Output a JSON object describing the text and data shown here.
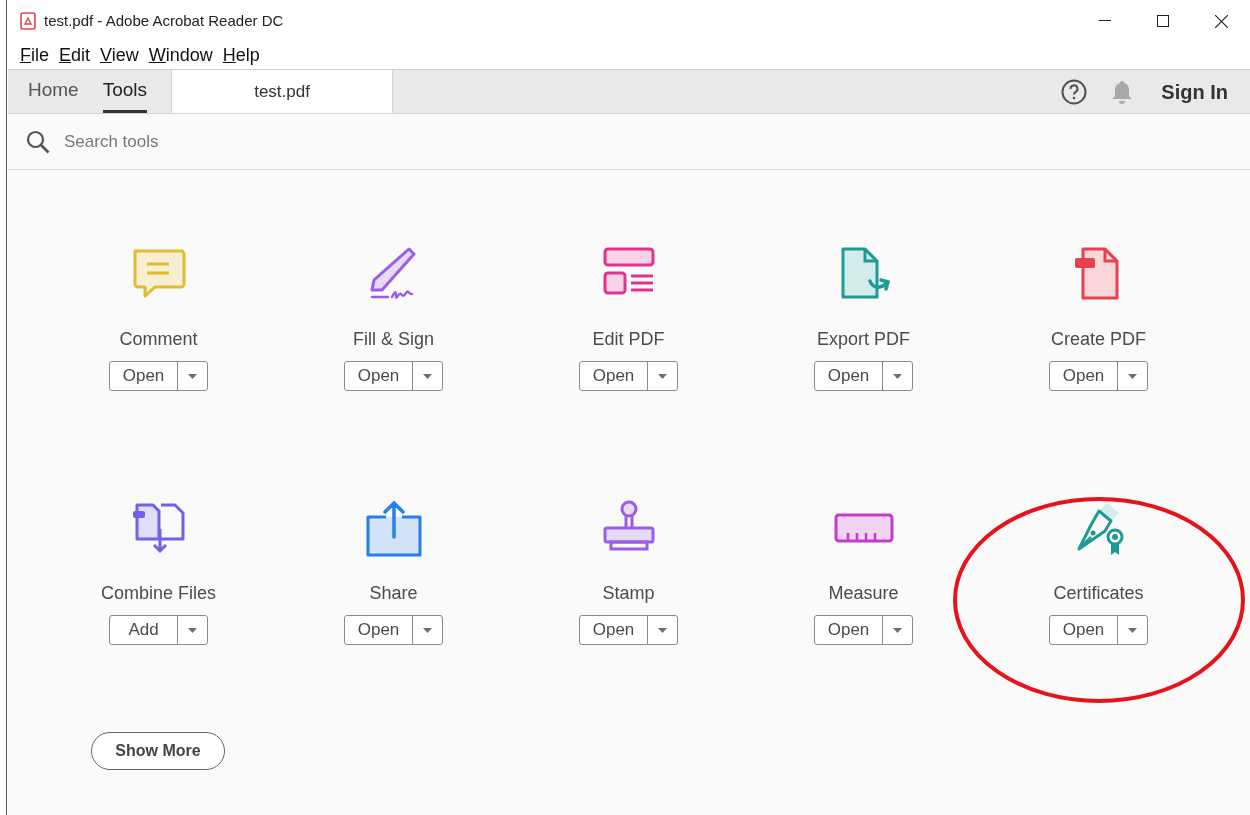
{
  "window": {
    "title": "test.pdf - Adobe Acrobat Reader DC"
  },
  "menu": [
    {
      "label": "File"
    },
    {
      "label": "Edit"
    },
    {
      "label": "View"
    },
    {
      "label": "Window"
    },
    {
      "label": "Help"
    }
  ],
  "tabs": [
    {
      "label": "Home",
      "selected": false
    },
    {
      "label": "Tools",
      "selected": true
    }
  ],
  "document_tab": {
    "label": "test.pdf"
  },
  "sign_in": "Sign In",
  "search": {
    "placeholder": "Search tools"
  },
  "tools": [
    {
      "kind": "comment",
      "name": "Comment",
      "action": "Open"
    },
    {
      "kind": "fillsign",
      "name": "Fill & Sign",
      "action": "Open"
    },
    {
      "kind": "editpdf",
      "name": "Edit PDF",
      "action": "Open"
    },
    {
      "kind": "exportpdf",
      "name": "Export PDF",
      "action": "Open"
    },
    {
      "kind": "createpdf",
      "name": "Create PDF",
      "action": "Open"
    },
    {
      "kind": "combine",
      "name": "Combine Files",
      "action": "Add"
    },
    {
      "kind": "share",
      "name": "Share",
      "action": "Open"
    },
    {
      "kind": "stamp",
      "name": "Stamp",
      "action": "Open"
    },
    {
      "kind": "measure",
      "name": "Measure",
      "action": "Open"
    },
    {
      "kind": "certificates",
      "name": "Certificates",
      "action": "Open",
      "circled": true
    }
  ],
  "show_more": "Show More"
}
